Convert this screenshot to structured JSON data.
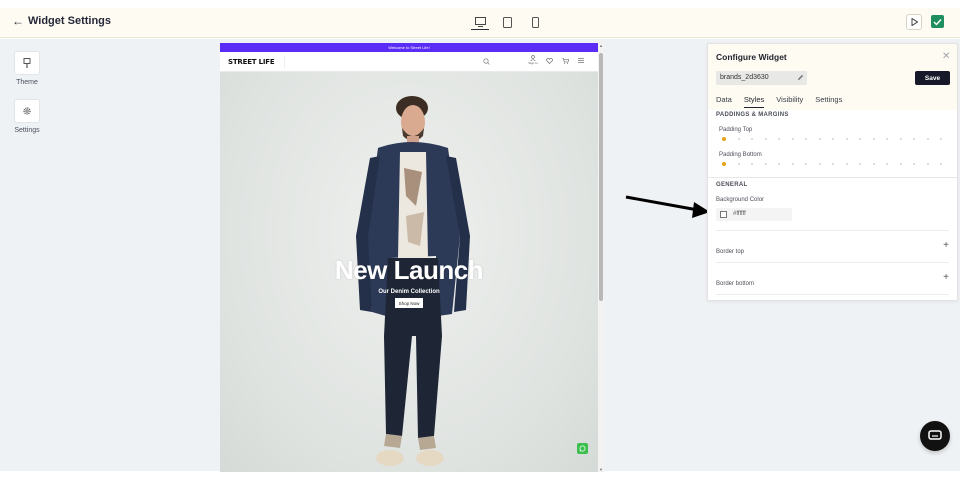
{
  "header": {
    "title": "Widget Settings",
    "devices": [
      "desktop",
      "tablet",
      "mobile"
    ],
    "active_device": "desktop"
  },
  "sidebar": {
    "tools": [
      {
        "label": "Theme",
        "icon": "brush-icon"
      },
      {
        "label": "Settings",
        "icon": "gear-icon"
      }
    ]
  },
  "preview": {
    "announcement": "Welcome to Street Life!",
    "logo": "STREET LIFE",
    "signin_label": "Sign In",
    "hero_title": "New Launch",
    "hero_subtitle": "Our Denim Collection",
    "cta_label": "Shop Now"
  },
  "panel": {
    "title": "Configure Widget",
    "widget_name": "brands_2d3630",
    "save_label": "Save",
    "tabs": [
      "Data",
      "Styles",
      "Visibility",
      "Settings"
    ],
    "active_tab": "Styles",
    "section_paddings": "PADDINGS & MARGINS",
    "padding_top_label": "Padding Top",
    "padding_top_value": 0,
    "padding_bottom_label": "Padding Bottom",
    "padding_bottom_value": 0,
    "section_general": "GENERAL",
    "bg_color_label": "Background Color",
    "bg_color_value": "#ffffff",
    "border_top_label": "Border top",
    "border_bottom_label": "Border bottom"
  },
  "colors": {
    "announcement_bar": "#5b2cf6",
    "save_button": "#17192a",
    "publish_check": "#1f8f5f",
    "slider_knob": "#e2a21a",
    "whatsapp": "#3cbf4f"
  }
}
